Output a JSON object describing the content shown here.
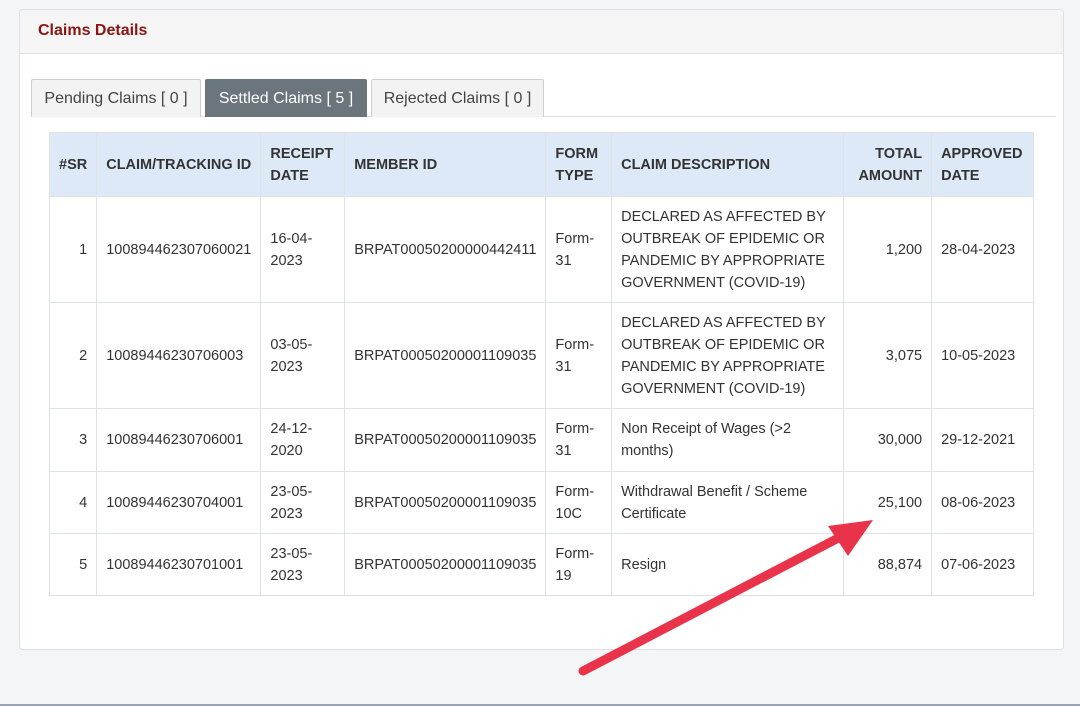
{
  "panel": {
    "title": "Claims Details"
  },
  "tabs": [
    {
      "label": "Pending Claims [ 0 ]",
      "active": false
    },
    {
      "label": "Settled Claims [ 5 ]",
      "active": true
    },
    {
      "label": "Rejected Claims [ 0 ]",
      "active": false
    }
  ],
  "table": {
    "headers": {
      "sr": "#SR",
      "claim_id": "CLAIM/TRACKING ID",
      "receipt_date": "RECEIPT DATE",
      "member_id": "MEMBER ID",
      "form_type": "FORM TYPE",
      "description": "CLAIM DESCRIPTION",
      "total_amount": "TOTAL AMOUNT",
      "approved_date": "APPROVED DATE"
    },
    "rows": [
      {
        "sr": "1",
        "claim_id": "100894462307060021",
        "receipt_date": "16-04-2023",
        "member_id": "BRPAT00050200000442411",
        "form_type": "Form-31",
        "description": "DECLARED AS AFFECTED BY OUTBREAK OF EPIDEMIC OR PANDEMIC BY APPROPRIATE GOVERNMENT (COVID-19)",
        "total_amount": "1,200",
        "approved_date": "28-04-2023"
      },
      {
        "sr": "2",
        "claim_id": "10089446230706003",
        "receipt_date": "03-05-2023",
        "member_id": "BRPAT00050200001109035",
        "form_type": "Form-31",
        "description": "DECLARED AS AFFECTED BY OUTBREAK OF EPIDEMIC OR PANDEMIC BY APPROPRIATE GOVERNMENT (COVID-19)",
        "total_amount": "3,075",
        "approved_date": "10-05-2023"
      },
      {
        "sr": "3",
        "claim_id": "10089446230706001",
        "receipt_date": "24-12-2020",
        "member_id": "BRPAT00050200001109035",
        "form_type": "Form-31",
        "description": "Non Receipt of Wages (>2 months)",
        "total_amount": "30,000",
        "approved_date": "29-12-2021"
      },
      {
        "sr": "4",
        "claim_id": "10089446230704001",
        "receipt_date": "23-05-2023",
        "member_id": "BRPAT00050200001109035",
        "form_type": "Form-10C",
        "description": "Withdrawal Benefit / Scheme Certificate",
        "total_amount": "25,100",
        "approved_date": "08-06-2023"
      },
      {
        "sr": "5",
        "claim_id": "10089446230701001",
        "receipt_date": "23-05-2023",
        "member_id": "BRPAT00050200001109035",
        "form_type": "Form-19",
        "description": "Resign",
        "total_amount": "88,874",
        "approved_date": "07-06-2023"
      }
    ]
  },
  "annotation": {
    "arrow_color": "#e8334a"
  }
}
